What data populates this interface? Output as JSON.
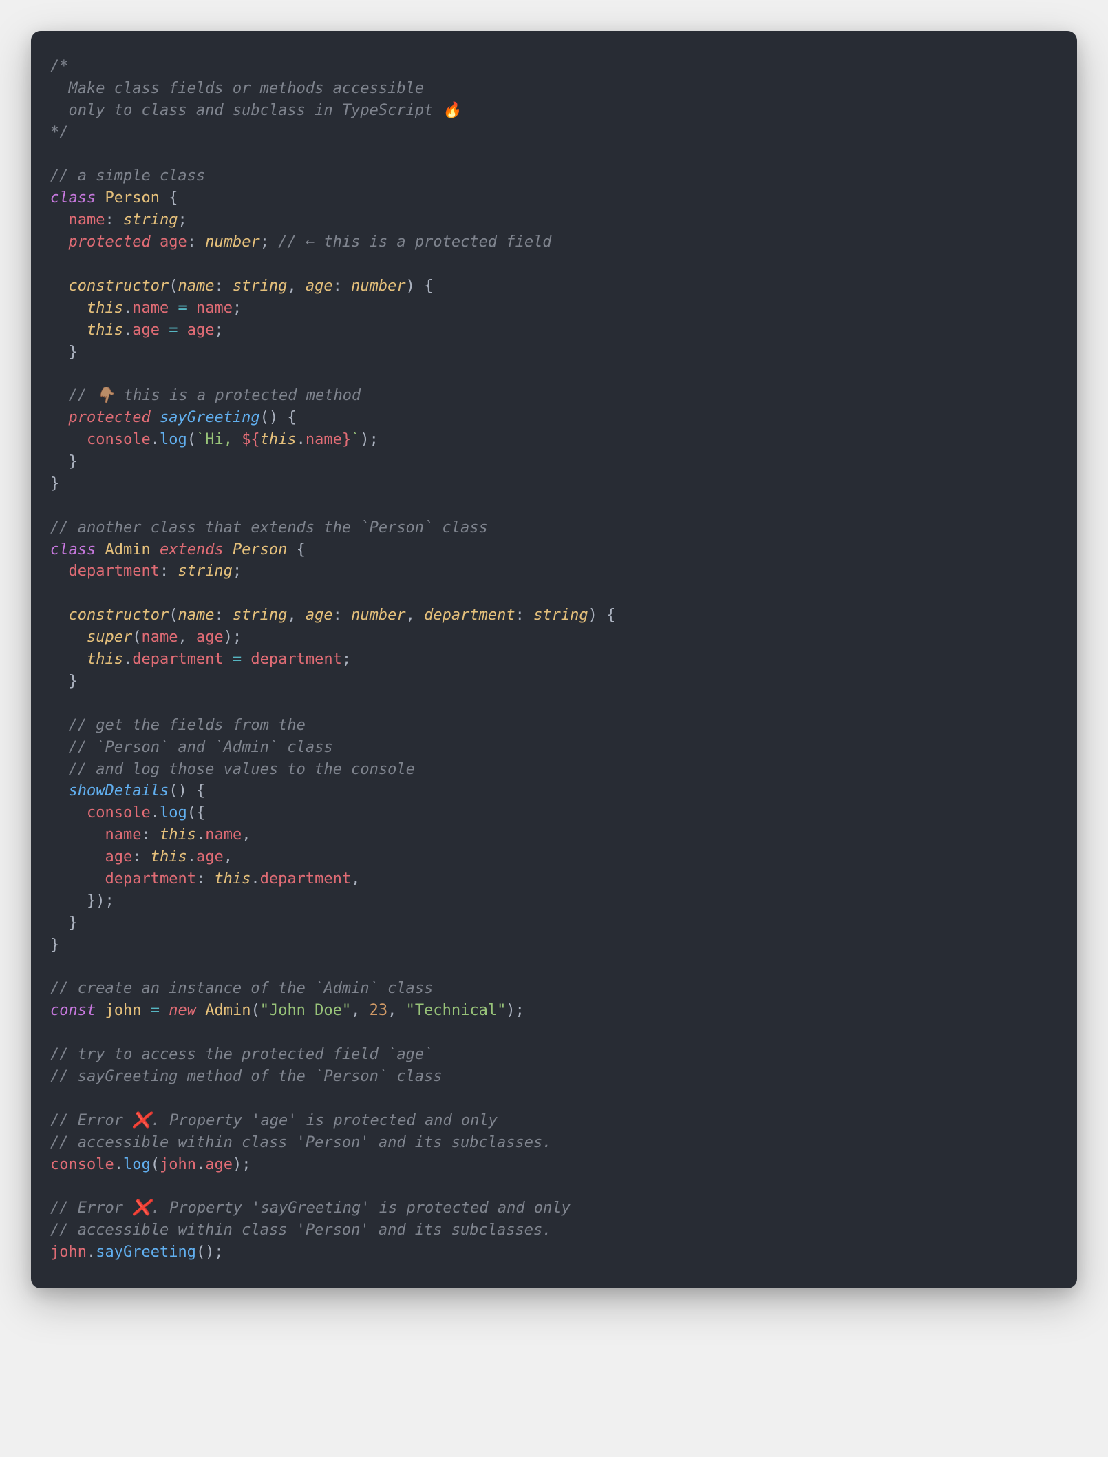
{
  "tokens": [
    [
      [
        "c",
        "/*"
      ]
    ],
    [
      [
        "c",
        "  Make class fields or methods accessible"
      ]
    ],
    [
      [
        "c",
        "  only to class and subclass in TypeScript 🔥"
      ]
    ],
    [
      [
        "c",
        "*/"
      ]
    ],
    [],
    [
      [
        "c",
        "// a simple class"
      ]
    ],
    [
      [
        "kw",
        "class"
      ],
      [
        "p",
        " "
      ],
      [
        "cls",
        "Person"
      ],
      [
        "p",
        " {"
      ]
    ],
    [
      [
        "p",
        "  "
      ],
      [
        "var",
        "name"
      ],
      [
        "p",
        ": "
      ],
      [
        "ty",
        "string"
      ],
      [
        "p",
        ";"
      ]
    ],
    [
      [
        "p",
        "  "
      ],
      [
        "mod",
        "protected"
      ],
      [
        "p",
        " "
      ],
      [
        "var",
        "age"
      ],
      [
        "p",
        ": "
      ],
      [
        "ty",
        "number"
      ],
      [
        "p",
        "; "
      ],
      [
        "c",
        "// ← this is a protected field"
      ]
    ],
    [],
    [
      [
        "p",
        "  "
      ],
      [
        "ctor",
        "constructor"
      ],
      [
        "p",
        "("
      ],
      [
        "prm",
        "name"
      ],
      [
        "p",
        ": "
      ],
      [
        "ty",
        "string"
      ],
      [
        "p",
        ", "
      ],
      [
        "prm",
        "age"
      ],
      [
        "p",
        ": "
      ],
      [
        "ty",
        "number"
      ],
      [
        "p",
        ") {"
      ]
    ],
    [
      [
        "p",
        "    "
      ],
      [
        "th",
        "this"
      ],
      [
        "p",
        "."
      ],
      [
        "var",
        "name"
      ],
      [
        "p",
        " "
      ],
      [
        "op",
        "="
      ],
      [
        "p",
        " "
      ],
      [
        "var",
        "name"
      ],
      [
        "p",
        ";"
      ]
    ],
    [
      [
        "p",
        "    "
      ],
      [
        "th",
        "this"
      ],
      [
        "p",
        "."
      ],
      [
        "var",
        "age"
      ],
      [
        "p",
        " "
      ],
      [
        "op",
        "="
      ],
      [
        "p",
        " "
      ],
      [
        "var",
        "age"
      ],
      [
        "p",
        ";"
      ]
    ],
    [
      [
        "p",
        "  }"
      ]
    ],
    [],
    [
      [
        "p",
        "  "
      ],
      [
        "c",
        "// 👇🏽 this is a protected method"
      ]
    ],
    [
      [
        "p",
        "  "
      ],
      [
        "mod",
        "protected"
      ],
      [
        "p",
        " "
      ],
      [
        "fnit",
        "sayGreeting"
      ],
      [
        "p",
        "() {"
      ]
    ],
    [
      [
        "p",
        "    "
      ],
      [
        "var",
        "console"
      ],
      [
        "p",
        "."
      ],
      [
        "fn",
        "log"
      ],
      [
        "p",
        "("
      ],
      [
        "str",
        "`Hi, "
      ],
      [
        "ti",
        "${"
      ],
      [
        "th",
        "this"
      ],
      [
        "p",
        "."
      ],
      [
        "var",
        "name"
      ],
      [
        "ti",
        "}"
      ],
      [
        "str",
        "`"
      ],
      [
        "p",
        ");"
      ]
    ],
    [
      [
        "p",
        "  }"
      ]
    ],
    [
      [
        "p",
        "}"
      ]
    ],
    [],
    [
      [
        "c",
        "// another class that extends the `Person` class"
      ]
    ],
    [
      [
        "kw",
        "class"
      ],
      [
        "p",
        " "
      ],
      [
        "cls",
        "Admin"
      ],
      [
        "p",
        " "
      ],
      [
        "mod",
        "extends"
      ],
      [
        "p",
        " "
      ],
      [
        "ty",
        "Person"
      ],
      [
        "p",
        " {"
      ]
    ],
    [
      [
        "p",
        "  "
      ],
      [
        "var",
        "department"
      ],
      [
        "p",
        ": "
      ],
      [
        "ty",
        "string"
      ],
      [
        "p",
        ";"
      ]
    ],
    [],
    [
      [
        "p",
        "  "
      ],
      [
        "ctor",
        "constructor"
      ],
      [
        "p",
        "("
      ],
      [
        "prm",
        "name"
      ],
      [
        "p",
        ": "
      ],
      [
        "ty",
        "string"
      ],
      [
        "p",
        ", "
      ],
      [
        "prm",
        "age"
      ],
      [
        "p",
        ": "
      ],
      [
        "ty",
        "number"
      ],
      [
        "p",
        ", "
      ],
      [
        "prm",
        "department"
      ],
      [
        "p",
        ": "
      ],
      [
        "ty",
        "string"
      ],
      [
        "p",
        ") {"
      ]
    ],
    [
      [
        "p",
        "    "
      ],
      [
        "th",
        "super"
      ],
      [
        "p",
        "("
      ],
      [
        "var",
        "name"
      ],
      [
        "p",
        ", "
      ],
      [
        "var",
        "age"
      ],
      [
        "p",
        ");"
      ]
    ],
    [
      [
        "p",
        "    "
      ],
      [
        "th",
        "this"
      ],
      [
        "p",
        "."
      ],
      [
        "var",
        "department"
      ],
      [
        "p",
        " "
      ],
      [
        "op",
        "="
      ],
      [
        "p",
        " "
      ],
      [
        "var",
        "department"
      ],
      [
        "p",
        ";"
      ]
    ],
    [
      [
        "p",
        "  }"
      ]
    ],
    [],
    [
      [
        "p",
        "  "
      ],
      [
        "c",
        "// get the fields from the"
      ]
    ],
    [
      [
        "p",
        "  "
      ],
      [
        "c",
        "// `Person` and `Admin` class"
      ]
    ],
    [
      [
        "p",
        "  "
      ],
      [
        "c",
        "// and log those values to the console"
      ]
    ],
    [
      [
        "p",
        "  "
      ],
      [
        "fnit",
        "showDetails"
      ],
      [
        "p",
        "() {"
      ]
    ],
    [
      [
        "p",
        "    "
      ],
      [
        "var",
        "console"
      ],
      [
        "p",
        "."
      ],
      [
        "fn",
        "log"
      ],
      [
        "p",
        "({"
      ]
    ],
    [
      [
        "p",
        "      "
      ],
      [
        "var",
        "name"
      ],
      [
        "p",
        ": "
      ],
      [
        "th",
        "this"
      ],
      [
        "p",
        "."
      ],
      [
        "var",
        "name"
      ],
      [
        "p",
        ","
      ]
    ],
    [
      [
        "p",
        "      "
      ],
      [
        "var",
        "age"
      ],
      [
        "p",
        ": "
      ],
      [
        "th",
        "this"
      ],
      [
        "p",
        "."
      ],
      [
        "var",
        "age"
      ],
      [
        "p",
        ","
      ]
    ],
    [
      [
        "p",
        "      "
      ],
      [
        "var",
        "department"
      ],
      [
        "p",
        ": "
      ],
      [
        "th",
        "this"
      ],
      [
        "p",
        "."
      ],
      [
        "var",
        "department"
      ],
      [
        "p",
        ","
      ]
    ],
    [
      [
        "p",
        "    });"
      ]
    ],
    [
      [
        "p",
        "  }"
      ]
    ],
    [
      [
        "p",
        "}"
      ]
    ],
    [],
    [
      [
        "c",
        "// create an instance of the `Admin` class"
      ]
    ],
    [
      [
        "kw",
        "const"
      ],
      [
        "p",
        " "
      ],
      [
        "vc",
        "john"
      ],
      [
        "p",
        " "
      ],
      [
        "op",
        "="
      ],
      [
        "p",
        " "
      ],
      [
        "mod",
        "new"
      ],
      [
        "p",
        " "
      ],
      [
        "cls",
        "Admin"
      ],
      [
        "p",
        "("
      ],
      [
        "str",
        "\"John Doe\""
      ],
      [
        "p",
        ", "
      ],
      [
        "num",
        "23"
      ],
      [
        "p",
        ", "
      ],
      [
        "str",
        "\"Technical\""
      ],
      [
        "p",
        ");"
      ]
    ],
    [],
    [
      [
        "c",
        "// try to access the protected field `age`"
      ]
    ],
    [
      [
        "c",
        "// sayGreeting method of the `Person` class"
      ]
    ],
    [],
    [
      [
        "c",
        "// Error ❌. Property 'age' is protected and only"
      ]
    ],
    [
      [
        "c",
        "// accessible within class 'Person' and its subclasses."
      ]
    ],
    [
      [
        "var",
        "console"
      ],
      [
        "p",
        "."
      ],
      [
        "fn",
        "log"
      ],
      [
        "p",
        "("
      ],
      [
        "var",
        "john"
      ],
      [
        "p",
        "."
      ],
      [
        "var",
        "age"
      ],
      [
        "p",
        ");"
      ]
    ],
    [],
    [
      [
        "c",
        "// Error ❌. Property 'sayGreeting' is protected and only"
      ]
    ],
    [
      [
        "c",
        "// accessible within class 'Person' and its subclasses."
      ]
    ],
    [
      [
        "var",
        "john"
      ],
      [
        "p",
        "."
      ],
      [
        "fn",
        "sayGreeting"
      ],
      [
        "p",
        "();"
      ]
    ]
  ]
}
